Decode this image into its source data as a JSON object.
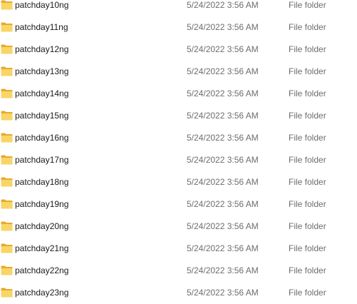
{
  "colors": {
    "folder_back": "#e8a92c",
    "folder_front": "#f8d567",
    "name_text": "#1a1a1a",
    "meta_text": "#6d6d6d"
  },
  "files": [
    {
      "name": "patchday10ng",
      "date_modified": "5/24/2022 3:56 AM",
      "type": "File folder",
      "icon": "folder-icon"
    },
    {
      "name": "patchday11ng",
      "date_modified": "5/24/2022 3:56 AM",
      "type": "File folder",
      "icon": "folder-icon"
    },
    {
      "name": "patchday12ng",
      "date_modified": "5/24/2022 3:56 AM",
      "type": "File folder",
      "icon": "folder-icon"
    },
    {
      "name": "patchday13ng",
      "date_modified": "5/24/2022 3:56 AM",
      "type": "File folder",
      "icon": "folder-icon"
    },
    {
      "name": "patchday14ng",
      "date_modified": "5/24/2022 3:56 AM",
      "type": "File folder",
      "icon": "folder-icon"
    },
    {
      "name": "patchday15ng",
      "date_modified": "5/24/2022 3:56 AM",
      "type": "File folder",
      "icon": "folder-icon"
    },
    {
      "name": "patchday16ng",
      "date_modified": "5/24/2022 3:56 AM",
      "type": "File folder",
      "icon": "folder-icon"
    },
    {
      "name": "patchday17ng",
      "date_modified": "5/24/2022 3:56 AM",
      "type": "File folder",
      "icon": "folder-icon"
    },
    {
      "name": "patchday18ng",
      "date_modified": "5/24/2022 3:56 AM",
      "type": "File folder",
      "icon": "folder-icon"
    },
    {
      "name": "patchday19ng",
      "date_modified": "5/24/2022 3:56 AM",
      "type": "File folder",
      "icon": "folder-icon"
    },
    {
      "name": "patchday20ng",
      "date_modified": "5/24/2022 3:56 AM",
      "type": "File folder",
      "icon": "folder-icon"
    },
    {
      "name": "patchday21ng",
      "date_modified": "5/24/2022 3:56 AM",
      "type": "File folder",
      "icon": "folder-icon"
    },
    {
      "name": "patchday22ng",
      "date_modified": "5/24/2022 3:56 AM",
      "type": "File folder",
      "icon": "folder-icon"
    },
    {
      "name": "patchday23ng",
      "date_modified": "5/24/2022 3:56 AM",
      "type": "File folder",
      "icon": "folder-icon"
    }
  ]
}
